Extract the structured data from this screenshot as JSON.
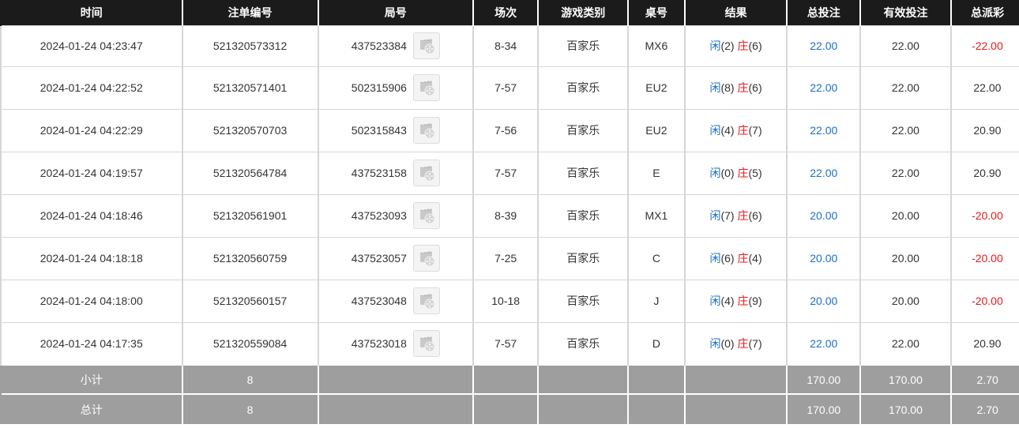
{
  "columns": [
    "时间",
    "注单编号",
    "局号",
    "场次",
    "游戏类别",
    "桌号",
    "结果",
    "总投注",
    "有效投注",
    "总派彩"
  ],
  "rows": [
    {
      "time": "2024-01-24 04:23:47",
      "order_no": "521320573312",
      "round_no": "437523384",
      "session": "8-34",
      "game": "百家乐",
      "table": "MX6",
      "player_label": "闲",
      "player_score": "(2)",
      "banker_label": "庄",
      "banker_score": "(6)",
      "total_bet": "22.00",
      "valid_bet": "22.00",
      "payout": "-22.00",
      "payout_negative": true
    },
    {
      "time": "2024-01-24 04:22:52",
      "order_no": "521320571401",
      "round_no": "502315906",
      "session": "7-57",
      "game": "百家乐",
      "table": "EU2",
      "player_label": "闲",
      "player_score": "(8)",
      "banker_label": "庄",
      "banker_score": "(6)",
      "total_bet": "22.00",
      "valid_bet": "22.00",
      "payout": "22.00",
      "payout_negative": false
    },
    {
      "time": "2024-01-24 04:22:29",
      "order_no": "521320570703",
      "round_no": "502315843",
      "session": "7-56",
      "game": "百家乐",
      "table": "EU2",
      "player_label": "闲",
      "player_score": "(4)",
      "banker_label": "庄",
      "banker_score": "(7)",
      "total_bet": "22.00",
      "valid_bet": "22.00",
      "payout": "20.90",
      "payout_negative": false
    },
    {
      "time": "2024-01-24 04:19:57",
      "order_no": "521320564784",
      "round_no": "437523158",
      "session": "7-57",
      "game": "百家乐",
      "table": "E",
      "player_label": "闲",
      "player_score": "(0)",
      "banker_label": "庄",
      "banker_score": "(5)",
      "total_bet": "22.00",
      "valid_bet": "22.00",
      "payout": "20.90",
      "payout_negative": false
    },
    {
      "time": "2024-01-24 04:18:46",
      "order_no": "521320561901",
      "round_no": "437523093",
      "session": "8-39",
      "game": "百家乐",
      "table": "MX1",
      "player_label": "闲",
      "player_score": "(7)",
      "banker_label": "庄",
      "banker_score": "(6)",
      "total_bet": "20.00",
      "valid_bet": "20.00",
      "payout": "-20.00",
      "payout_negative": true
    },
    {
      "time": "2024-01-24 04:18:18",
      "order_no": "521320560759",
      "round_no": "437523057",
      "session": "7-25",
      "game": "百家乐",
      "table": "C",
      "player_label": "闲",
      "player_score": "(6)",
      "banker_label": "庄",
      "banker_score": "(4)",
      "total_bet": "20.00",
      "valid_bet": "20.00",
      "payout": "-20.00",
      "payout_negative": true
    },
    {
      "time": "2024-01-24 04:18:00",
      "order_no": "521320560157",
      "round_no": "437523048",
      "session": "10-18",
      "game": "百家乐",
      "table": "J",
      "player_label": "闲",
      "player_score": "(4)",
      "banker_label": "庄",
      "banker_score": "(9)",
      "total_bet": "20.00",
      "valid_bet": "20.00",
      "payout": "-20.00",
      "payout_negative": true
    },
    {
      "time": "2024-01-24 04:17:35",
      "order_no": "521320559084",
      "round_no": "437523018",
      "session": "7-57",
      "game": "百家乐",
      "table": "D",
      "player_label": "闲",
      "player_score": "(0)",
      "banker_label": "庄",
      "banker_score": "(7)",
      "total_bet": "22.00",
      "valid_bet": "22.00",
      "payout": "20.90",
      "payout_negative": false
    }
  ],
  "subtotal": {
    "label": "小计",
    "count": "8",
    "total_bet": "170.00",
    "valid_bet": "170.00",
    "payout": "2.70"
  },
  "total": {
    "label": "总计",
    "count": "8",
    "total_bet": "170.00",
    "valid_bet": "170.00",
    "payout": "2.70"
  },
  "icons": {
    "replay": "video-replay-icon"
  },
  "colors": {
    "header_bg": "#1b1b1b",
    "footer_bg": "#9e9e9e",
    "player": "#1a6fc9",
    "banker": "#e31b1b",
    "negative": "#e31b1b",
    "bet_amount": "#1a6fc9"
  }
}
